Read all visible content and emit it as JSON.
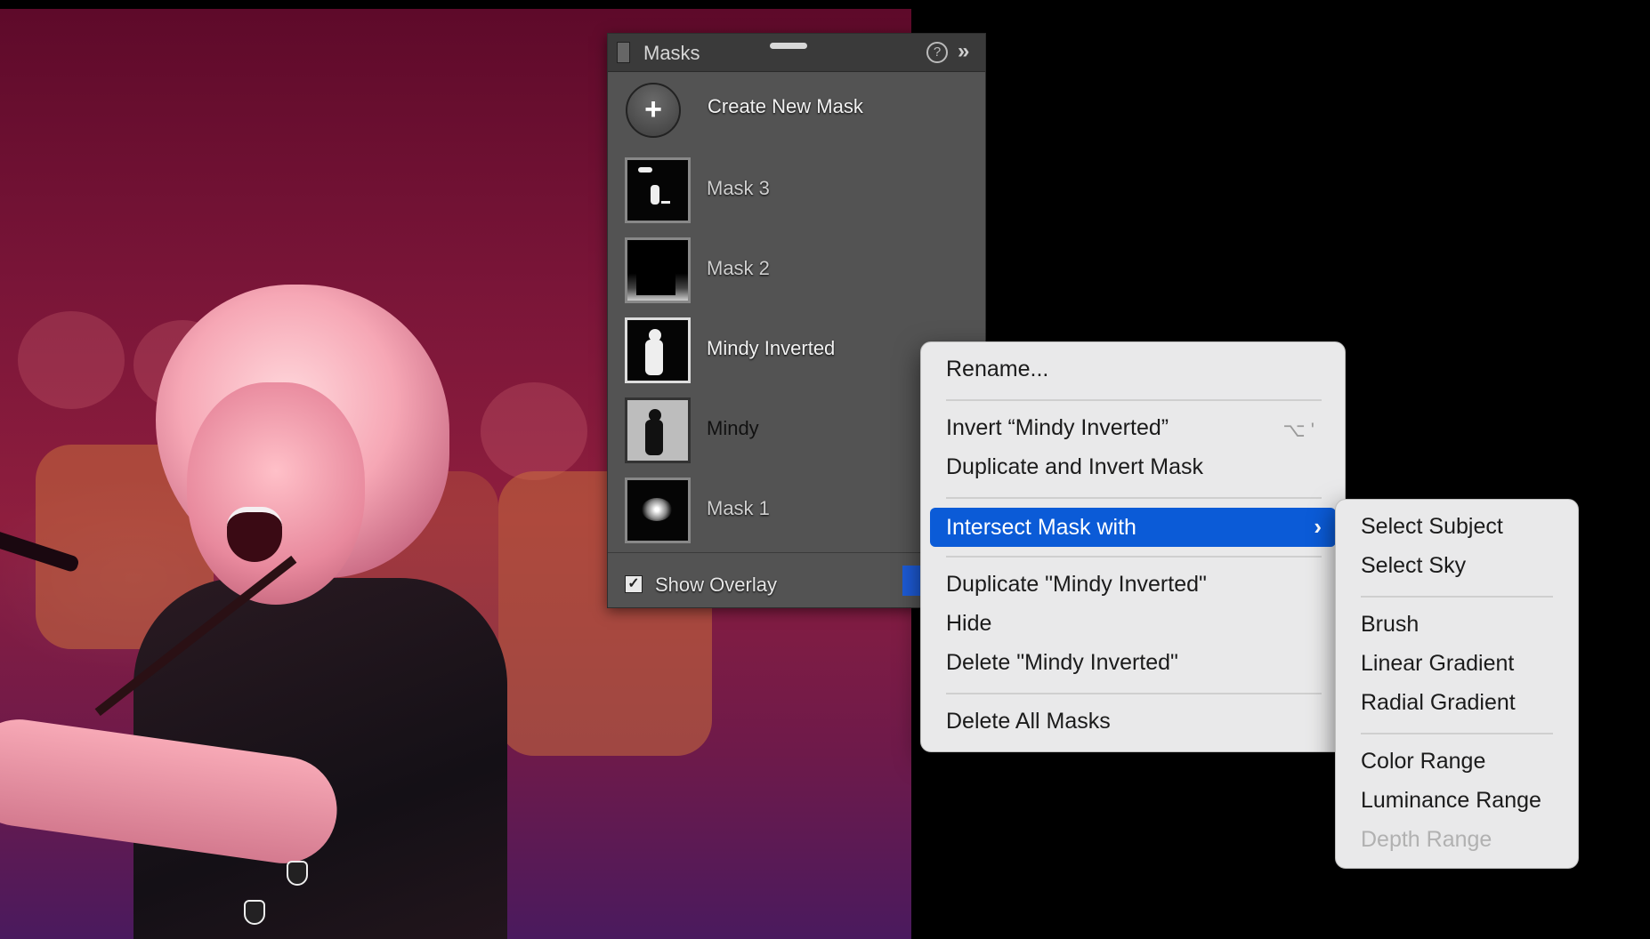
{
  "masks_panel": {
    "title": "Masks",
    "help_glyph": "?",
    "collapse_glyph": "»",
    "create_glyph": "+",
    "create_label": "Create New Mask",
    "masks": [
      {
        "name": "Mask 3"
      },
      {
        "name": "Mask 2"
      },
      {
        "name": "Mindy Inverted",
        "more": "••"
      },
      {
        "name": "Mindy"
      },
      {
        "name": "Mask 1"
      }
    ],
    "show_overlay": {
      "label": "Show Overlay",
      "checked": true,
      "check_glyph": "✓"
    }
  },
  "context_menu": {
    "items": [
      {
        "label": "Rename..."
      },
      {
        "label": "Invert “Mindy Inverted”",
        "shortcut": "⌥ '"
      },
      {
        "label": "Duplicate and Invert Mask"
      },
      {
        "label": "Intersect Mask with",
        "highlighted": true,
        "chevron": "›"
      },
      {
        "label": "Duplicate \"Mindy Inverted\""
      },
      {
        "label": "Hide"
      },
      {
        "label": "Delete \"Mindy Inverted\""
      },
      {
        "label": "Delete All Masks"
      }
    ]
  },
  "submenu": {
    "items": [
      {
        "label": "Select Subject"
      },
      {
        "label": "Select Sky"
      },
      {
        "label": "Brush"
      },
      {
        "label": "Linear Gradient"
      },
      {
        "label": "Radial Gradient"
      },
      {
        "label": "Color Range"
      },
      {
        "label": "Luminance Range"
      },
      {
        "label": "Depth Range",
        "disabled": true
      }
    ]
  },
  "colors": {
    "highlight": "#0b5bd7",
    "panel_bg": "#535353",
    "menu_bg": "#e9e9ea"
  }
}
